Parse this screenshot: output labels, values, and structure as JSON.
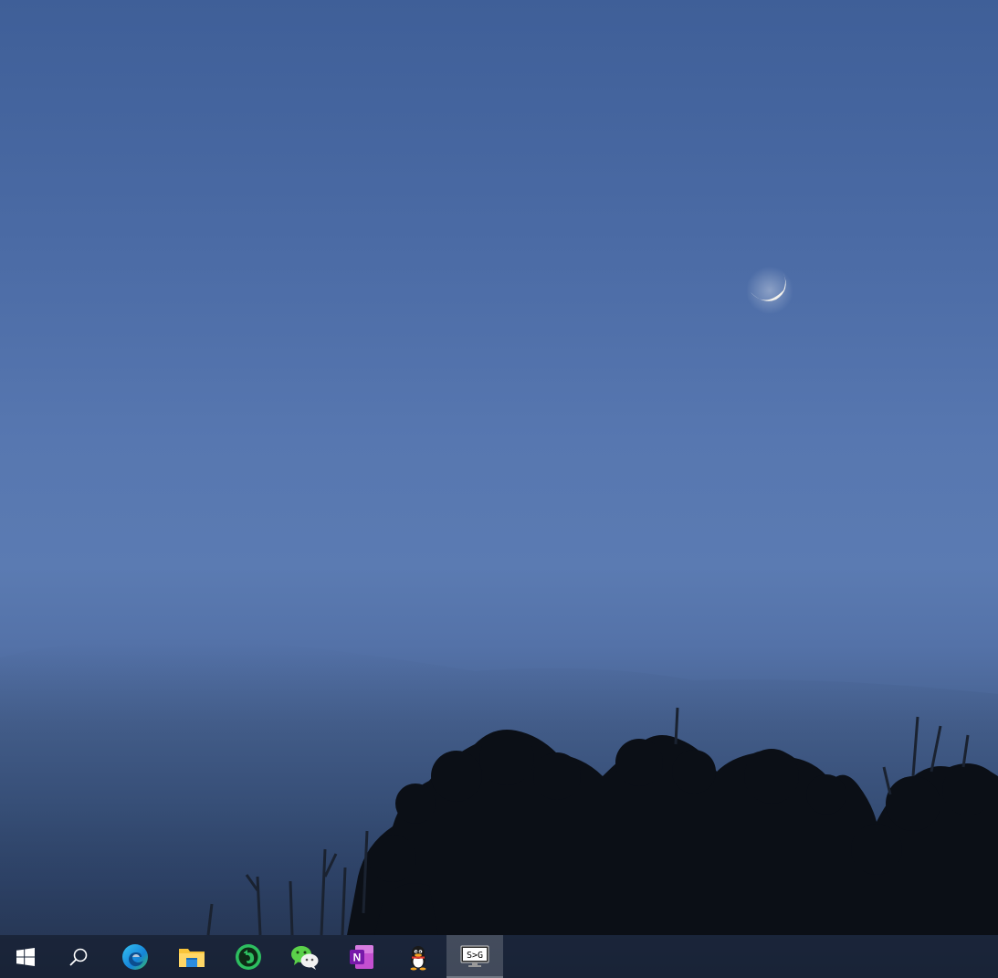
{
  "wallpaper": {
    "description_icon": "crescent-moon-icon",
    "sky_color": "#4f6fa8",
    "tree_color": "#0b0f16"
  },
  "taskbar": {
    "start": {
      "icon": "windows-logo-icon"
    },
    "search": {
      "icon": "search-icon"
    },
    "apps": [
      {
        "icon": "edge-icon"
      },
      {
        "icon": "file-explorer-icon"
      },
      {
        "icon": "evernote-icon"
      },
      {
        "icon": "wechat-icon"
      },
      {
        "icon": "onenote-icon",
        "badge": "N"
      },
      {
        "icon": "qq-icon"
      },
      {
        "icon": "sg-monitor-icon",
        "label": "S>G",
        "active": true
      }
    ]
  }
}
